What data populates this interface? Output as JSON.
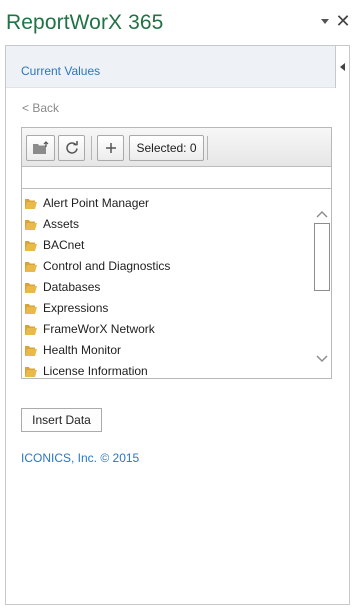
{
  "app": {
    "title": "ReportWorX 365",
    "title_color": "#217346",
    "dropdown_icon": "caret-down-icon",
    "close_icon": "close-icon",
    "close_glyph": "✕"
  },
  "pane": {
    "section_title": "Current Values",
    "collapse_icon": "caret-left-icon",
    "back_label": "< Back"
  },
  "toolbar": {
    "buttons": [
      {
        "icon": "folder-up-icon"
      },
      {
        "icon": "refresh-icon"
      },
      {
        "icon": "plus-icon"
      }
    ],
    "selected_label": "Selected: 0"
  },
  "filter": {
    "value": "",
    "placeholder": ""
  },
  "tree": {
    "items": [
      {
        "label": "Alert Point Manager",
        "icon": "folder-icon"
      },
      {
        "label": "Assets",
        "icon": "folder-icon"
      },
      {
        "label": "BACnet",
        "icon": "folder-icon"
      },
      {
        "label": "Control and Diagnostics",
        "icon": "folder-icon"
      },
      {
        "label": "Databases",
        "icon": "folder-icon"
      },
      {
        "label": "Expressions",
        "icon": "folder-icon"
      },
      {
        "label": "FrameWorX Network",
        "icon": "folder-icon"
      },
      {
        "label": "Health Monitor",
        "icon": "folder-icon"
      },
      {
        "label": "License Information",
        "icon": "folder-icon"
      }
    ]
  },
  "actions": {
    "insert_label": "Insert Data"
  },
  "footer": {
    "copyright": "ICONICS, Inc. © 2015"
  },
  "colors": {
    "accent": "#2b77c1",
    "header_bg": "#eef1f5",
    "folder": "#e9b949"
  }
}
